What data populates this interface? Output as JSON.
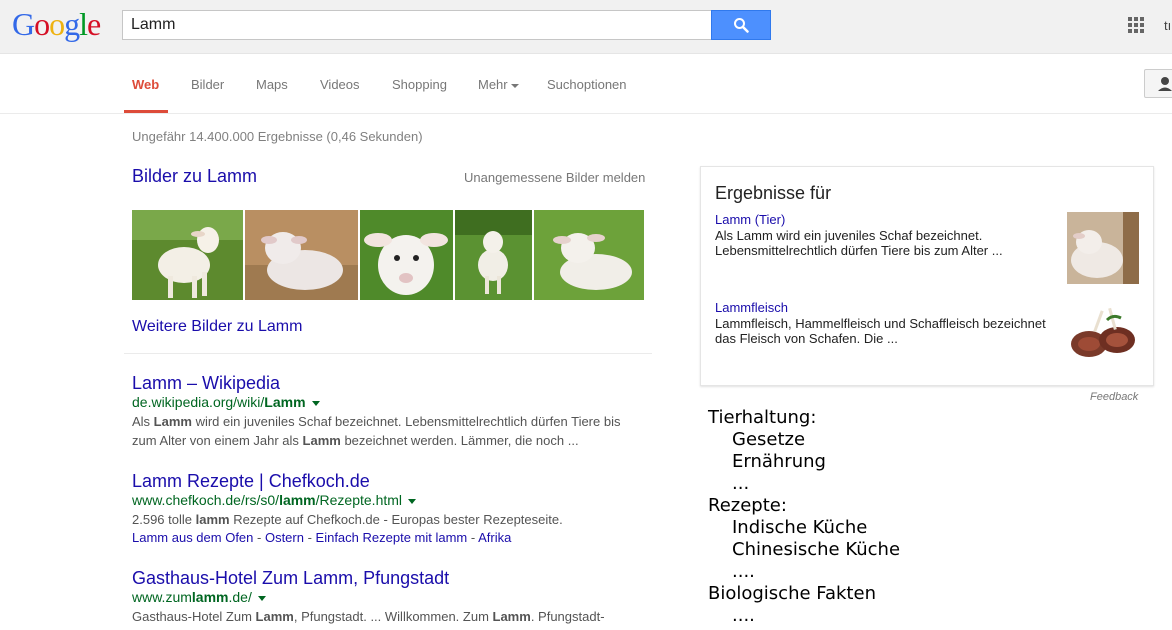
{
  "header": {
    "logo_letters": [
      {
        "ch": "G",
        "color": "#3369e8"
      },
      {
        "ch": "o",
        "color": "#d50f25"
      },
      {
        "ch": "o",
        "color": "#eeb211"
      },
      {
        "ch": "g",
        "color": "#3369e8"
      },
      {
        "ch": "l",
        "color": "#009925"
      },
      {
        "ch": "e",
        "color": "#d50f25"
      }
    ],
    "search_value": "Lamm",
    "user_trunc": "tı"
  },
  "nav": {
    "tabs": [
      {
        "label": "Web",
        "active": true
      },
      {
        "label": "Bilder",
        "active": false
      },
      {
        "label": "Maps",
        "active": false
      },
      {
        "label": "Videos",
        "active": false
      },
      {
        "label": "Shopping",
        "active": false
      },
      {
        "label": "Mehr",
        "active": false
      },
      {
        "label": "Suchoptionen",
        "active": false
      }
    ]
  },
  "stats": "Ungefähr 14.400.000 Ergebnisse (0,46 Sekunden)",
  "images": {
    "title": "Bilder zu Lamm",
    "report": "Unangemessene Bilder melden",
    "more": "Weitere Bilder zu Lamm"
  },
  "results": [
    {
      "title": "Lamm – Wikipedia",
      "url_pre": "de.wikipedia.org/wiki/",
      "url_bold": "Lamm",
      "url_post": "",
      "snippet_1": "Als ",
      "snippet_b1": "Lamm",
      "snippet_2": " wird ein juveniles Schaf bezeichnet. Lebensmittelrechtlich dürfen Tiere bis zum Alter von einem Jahr als ",
      "snippet_b2": "Lamm",
      "snippet_3": " bezeichnet werden. Lämmer, die noch ..."
    },
    {
      "title": "Lamm Rezepte | Chefkoch.de",
      "url_pre": "www.chefkoch.de/rs/s0/",
      "url_bold": "lamm",
      "url_post": "/Rezepte.html",
      "snippet_1": "2.596 tolle ",
      "snippet_b1": "lamm",
      "snippet_2": " Rezepte auf Chefkoch.de - Europas bester Rezepteseite.",
      "links": [
        "Lamm aus dem Ofen",
        "Ostern",
        "Einfach Rezepte mit lamm",
        "Afrika"
      ]
    },
    {
      "title": "Gasthaus-Hotel Zum Lamm, Pfungstadt",
      "url_pre": "www.zum",
      "url_bold": "lamm",
      "url_post": ".de/",
      "snippet_1": "Gasthaus-Hotel Zum ",
      "snippet_b1": "Lamm",
      "snippet_2": ", Pfungstadt. ... Willkommen. Zum ",
      "snippet_b2": "Lamm",
      "snippet_3": ". Pfungstadt-Eschollbrücken. Wählen Sie Ihre Sprache. deutsch · english · französisch"
    }
  ],
  "knowledge_panel": {
    "title": "Ergebnisse für",
    "items": [
      {
        "link": "Lamm (Tier)",
        "text": "Als Lamm wird ein juveniles Schaf bezeichnet. Lebensmittelrechtlich dürfen Tiere bis zum Alter ..."
      },
      {
        "link": "Lammfleisch",
        "text": "Lammfleisch, Hammelfleisch und Schaffleisch bezeichnet das Fleisch von Schafen. Die ..."
      }
    ],
    "feedback": "Feedback"
  },
  "outline": [
    {
      "text": "Tierhaltung:",
      "level": 1
    },
    {
      "text": "Gesetze",
      "level": 2
    },
    {
      "text": "Ernährung",
      "level": 2
    },
    {
      "text": "...",
      "level": 2
    },
    {
      "text": "Rezepte:",
      "level": 1
    },
    {
      "text": "Indische Küche",
      "level": 2
    },
    {
      "text": "Chinesische Küche",
      "level": 2
    },
    {
      "text": "....",
      "level": 2
    },
    {
      "text": "Biologische Fakten",
      "level": 1
    },
    {
      "text": "....",
      "level": 2
    }
  ]
}
